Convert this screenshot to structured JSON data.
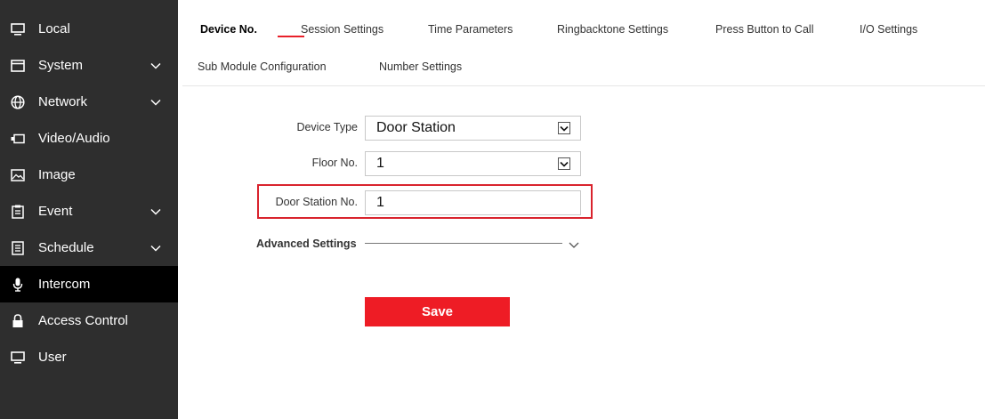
{
  "sidebar": {
    "items": [
      {
        "label": "Local",
        "icon": "monitor-icon",
        "expandable": false,
        "active": false
      },
      {
        "label": "System",
        "icon": "window-icon",
        "expandable": true,
        "active": false
      },
      {
        "label": "Network",
        "icon": "globe-icon",
        "expandable": true,
        "active": false
      },
      {
        "label": "Video/Audio",
        "icon": "camera-icon",
        "expandable": false,
        "active": false
      },
      {
        "label": "Image",
        "icon": "image-icon",
        "expandable": false,
        "active": false
      },
      {
        "label": "Event",
        "icon": "clipboard-icon",
        "expandable": true,
        "active": false
      },
      {
        "label": "Schedule",
        "icon": "calendar-icon",
        "expandable": true,
        "active": false
      },
      {
        "label": "Intercom",
        "icon": "microphone-icon",
        "expandable": false,
        "active": true
      },
      {
        "label": "Access Control",
        "icon": "lock-icon",
        "expandable": false,
        "active": false
      },
      {
        "label": "User",
        "icon": "monitor-icon",
        "expandable": false,
        "active": false
      }
    ]
  },
  "tabs": {
    "row1": [
      "Device No.",
      "Session Settings",
      "Time Parameters",
      "Ringbacktone Settings",
      "Press Button to Call",
      "I/O Settings"
    ],
    "row2": [
      "Sub Module Configuration",
      "Number Settings"
    ],
    "active": "Device No."
  },
  "form": {
    "device_type": {
      "label": "Device Type",
      "value": "Door Station"
    },
    "floor_no": {
      "label": "Floor No.",
      "value": "1"
    },
    "door_station_no": {
      "label": "Door Station No.",
      "value": "1"
    },
    "advanced_label": "Advanced Settings"
  },
  "save_label": "Save",
  "colors": {
    "accent": "#ee1c25",
    "sidebar_bg": "#2e2e2e",
    "sidebar_active_bg": "#000000",
    "highlight_border": "#d9232d"
  }
}
